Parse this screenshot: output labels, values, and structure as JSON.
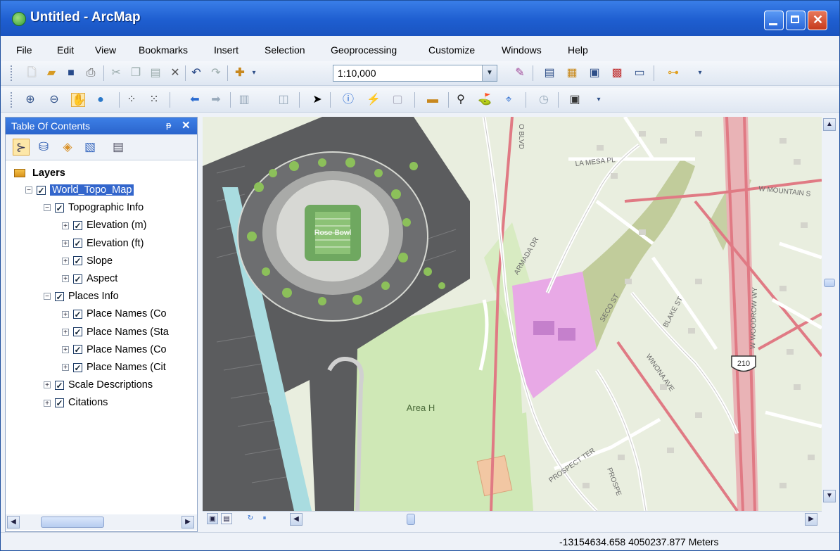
{
  "window": {
    "title": "Untitled - ArcMap",
    "icons": [
      "arcmap-globe-icon",
      "minimize-icon",
      "maximize-icon",
      "close-icon"
    ]
  },
  "menu": {
    "items": [
      "File",
      "Edit",
      "View",
      "Bookmarks",
      "Insert",
      "Selection",
      "Geoprocessing",
      "Customize",
      "Windows",
      "Help"
    ]
  },
  "standard_toolbar": {
    "scale_value": "1:10,000",
    "icons": [
      "new-document-icon",
      "open-folder-icon",
      "save-icon",
      "print-icon",
      "cut-icon",
      "copy-icon",
      "paste-icon",
      "delete-icon",
      "undo-icon",
      "redo-icon",
      "add-data-icon",
      "scale-dropdown-icon",
      "editor-toolbar-icon",
      "table-of-contents-icon",
      "catalog-icon",
      "search-window-icon",
      "arctoolbox-icon",
      "python-window-icon",
      "modelbuilder-icon"
    ]
  },
  "tools_toolbar": {
    "icons": [
      "zoom-in-icon",
      "zoom-out-icon",
      "pan-icon",
      "full-extent-icon",
      "fixed-zoom-in-icon",
      "fixed-zoom-out-icon",
      "back-extent-icon",
      "forward-extent-icon",
      "select-features-icon",
      "clear-selection-icon",
      "select-elements-icon",
      "identify-icon",
      "hyperlink-icon",
      "html-popup-icon",
      "measure-icon",
      "find-icon",
      "find-route-icon",
      "go-to-xy-icon",
      "time-slider-icon",
      "viewer-window-icon"
    ]
  },
  "toc": {
    "title": "Table Of Contents",
    "pin_glyph": "ᵽ",
    "close_glyph": "✕",
    "tool_icons": [
      "list-by-drawing-order-icon",
      "list-by-source-icon",
      "list-by-visibility-icon",
      "list-by-selection-icon",
      "options-icon"
    ],
    "root_label": "Layers",
    "items": [
      {
        "label": "World_Topo_Map",
        "level": 0,
        "expanded": true,
        "selected": true
      },
      {
        "label": "Topographic Info",
        "level": 1,
        "expanded": true
      },
      {
        "label": "Elevation (m)",
        "level": 2,
        "expanded": false
      },
      {
        "label": "Elevation (ft)",
        "level": 2,
        "expanded": false
      },
      {
        "label": "Slope",
        "level": 2,
        "expanded": false
      },
      {
        "label": "Aspect",
        "level": 2,
        "expanded": false
      },
      {
        "label": "Places Info",
        "level": 1,
        "expanded": true
      },
      {
        "label": "Place Names (Co",
        "level": 2,
        "expanded": false
      },
      {
        "label": "Place Names (Sta",
        "level": 2,
        "expanded": false
      },
      {
        "label": "Place Names (Co",
        "level": 2,
        "expanded": false
      },
      {
        "label": "Place Names (Cit",
        "level": 2,
        "expanded": false
      },
      {
        "label": "Scale Descriptions",
        "level": 1,
        "expanded": false
      },
      {
        "label": "Citations",
        "level": 1,
        "expanded": false
      }
    ]
  },
  "map": {
    "labels": {
      "rose_bowl": "Rose Bowl",
      "area_h": "Area H",
      "la_mesa_pl": "LA MESA PL",
      "armada_dr": "ARMADA DR",
      "seco_st": "SECO ST",
      "blake_st": "BLAKE ST",
      "winona_ave": "WINONA AVE",
      "prospect_ter": "PROSPECT TER",
      "prospect": "PROSPE",
      "woodrow_wy": "W WOODROW WY",
      "highway_shield": "210",
      "mountain_st": "W MOUNTAIN S",
      "blvd": "O BLVD"
    },
    "colors": {
      "land": "#e9eedf",
      "park": "#cfe8b6",
      "parking": "#5b5c5e",
      "freeway": "#e07a84",
      "river": "#a9dce0",
      "pink_zone": "#e8a9e6"
    }
  },
  "view_buttons": {
    "icons": [
      "data-view-icon",
      "layout-view-icon",
      "refresh-icon",
      "pause-drawing-icon"
    ]
  },
  "status": {
    "coordinates": "-13154634.658  4050237.877 Meters"
  }
}
